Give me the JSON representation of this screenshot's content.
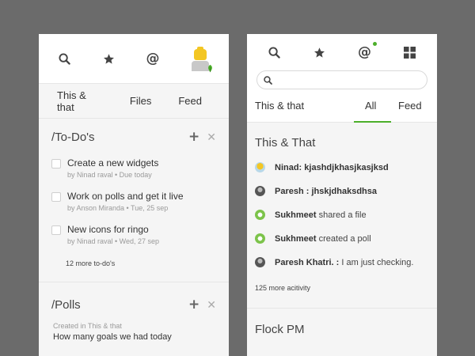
{
  "left": {
    "tabs": [
      "This & that",
      "Files",
      "Feed"
    ],
    "todos": {
      "title": "/To-Do's",
      "items": [
        {
          "title": "Create a new widgets",
          "meta": "by Ninad raval  • Due today"
        },
        {
          "title": "Work on polls and get it live",
          "meta": "by Anson Miranda  • Tue, 25 sep"
        },
        {
          "title": "New icons for ringo",
          "meta": "by Ninad raval  • Wed, 27 sep"
        }
      ],
      "more": "12 more to-do's"
    },
    "polls": {
      "title": "/Polls",
      "meta": "Created in This & that",
      "question": "How many goals we had today"
    }
  },
  "right": {
    "tabs": {
      "this": "This & that",
      "all": "All",
      "feed": "Feed"
    },
    "this_and_that": {
      "title": "This & That",
      "items": [
        {
          "name": "Ninad:",
          "text": "kjashdjkhasjkasjksd",
          "avatar": "yellow"
        },
        {
          "name": "Paresh :",
          "text": "jhskjdhaksdhsa",
          "avatar": "gray"
        },
        {
          "name": "Sukhmeet",
          "text": "shared a file",
          "avatar": "green"
        },
        {
          "name": "Sukhmeet",
          "text": "created a poll",
          "avatar": "green"
        },
        {
          "name": "Paresh Khatri. :",
          "text": "I am just checking.",
          "avatar": "gray"
        }
      ],
      "more": "125 more acitivity"
    },
    "flock": {
      "title": "Flock PM"
    }
  },
  "colors": {
    "accent": "#4caf2a",
    "background": "#6b6b6b",
    "panel": "#f5f5f5"
  }
}
